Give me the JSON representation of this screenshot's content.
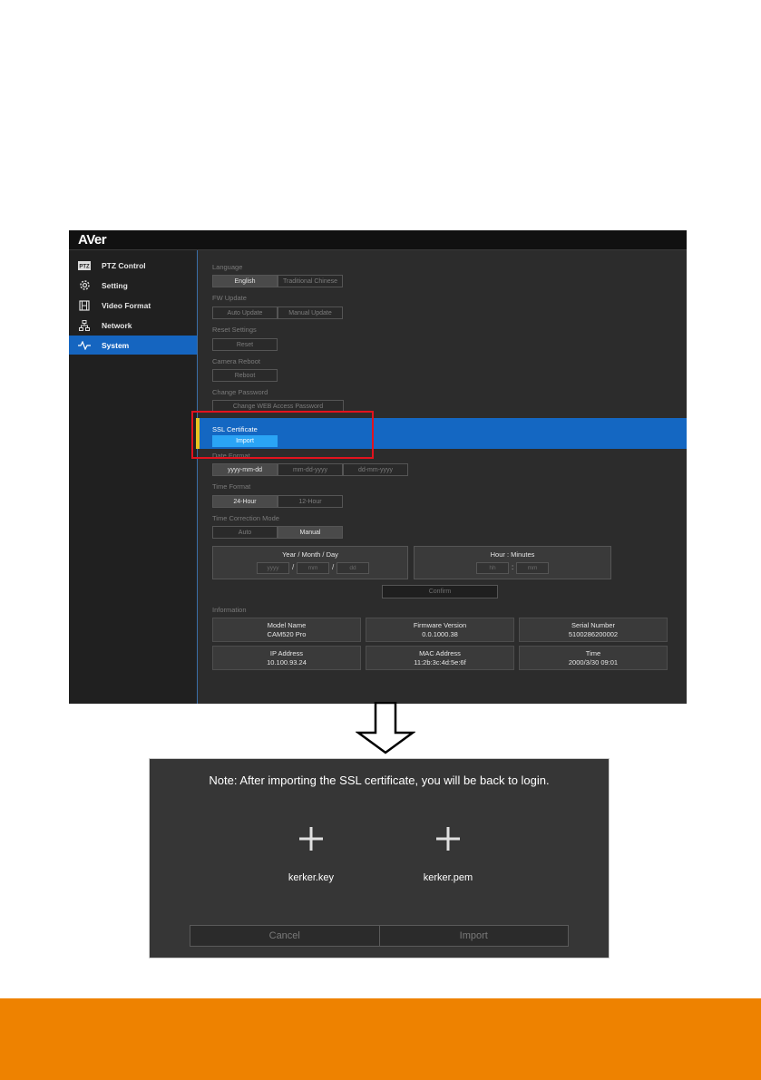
{
  "app": {
    "logo": "AVer",
    "sidebar": {
      "items": [
        {
          "label": "PTZ Control",
          "icon": "ptz-icon"
        },
        {
          "label": "Setting",
          "icon": "gear-icon"
        },
        {
          "label": "Video Format",
          "icon": "film-icon"
        },
        {
          "label": "Network",
          "icon": "network-icon"
        },
        {
          "label": "System",
          "icon": "pulse-icon",
          "active": true
        }
      ]
    },
    "language": {
      "label": "Language",
      "options": [
        "English",
        "Traditional Chinese"
      ],
      "selected": "English"
    },
    "fw_update": {
      "label": "FW Update",
      "options": [
        "Auto Update",
        "Manual Update"
      ]
    },
    "reset": {
      "label": "Reset Settings",
      "button": "Reset"
    },
    "reboot": {
      "label": "Camera Reboot",
      "button": "Reboot"
    },
    "password": {
      "label": "Change Password",
      "button": "Change WEB Access Password"
    },
    "ssl": {
      "label": "SSL Certificate",
      "button": "Import"
    },
    "date_format": {
      "label": "Date Format",
      "options": [
        "yyyy-mm-dd",
        "mm-dd-yyyy",
        "dd-mm-yyyy"
      ],
      "selected": "yyyy-mm-dd"
    },
    "time_format": {
      "label": "Time Format",
      "options": [
        "24-Hour",
        "12-Hour"
      ],
      "selected": "24-Hour"
    },
    "time_mode": {
      "label": "Time Correction Mode",
      "options": [
        "Auto",
        "Manual"
      ],
      "selected": "Manual"
    },
    "date_input": {
      "title": "Year / Month / Day",
      "fields": [
        "yyyy",
        "mm",
        "dd"
      ],
      "sep": "/"
    },
    "time_input": {
      "title": "Hour : Minutes",
      "fields": [
        "hh",
        "mm"
      ],
      "sep": ":"
    },
    "confirm": "Confirm",
    "information": {
      "label": "Information",
      "cells": [
        {
          "title": "Model Name",
          "value": "CAM520 Pro"
        },
        {
          "title": "Firmware Version",
          "value": "0.0.1000.38"
        },
        {
          "title": "Serial Number",
          "value": "5100286200002"
        },
        {
          "title": "IP Address",
          "value": "10.100.93.24"
        },
        {
          "title": "MAC Address",
          "value": "11:2b:3c:4d:5e:6f"
        },
        {
          "title": "Time",
          "value": "2000/3/30 09:01"
        }
      ]
    }
  },
  "dialog": {
    "note": "Note: After importing the SSL certificate, you will be back to login.",
    "files": [
      {
        "name": "kerker.key",
        "icon": "plus-icon"
      },
      {
        "name": "kerker.pem",
        "icon": "plus-icon"
      }
    ],
    "cancel": "Cancel",
    "import": "Import"
  },
  "colors": {
    "highlight_band": "#1467c2",
    "accent_button": "#2aa4f5",
    "callout_border": "#e1131e",
    "footer": "#ee8200"
  }
}
